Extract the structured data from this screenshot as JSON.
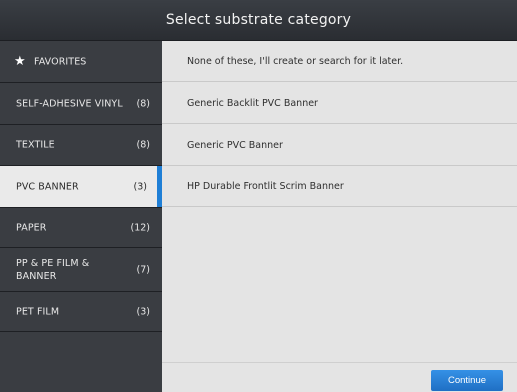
{
  "header": {
    "title": "Select substrate category"
  },
  "sidebar": {
    "items": [
      {
        "label": "FAVORITES",
        "count": "",
        "icon": "star-icon"
      },
      {
        "label": "SELF-ADHESIVE VINYL",
        "count": "(8)"
      },
      {
        "label": "TEXTILE",
        "count": "(8)"
      },
      {
        "label": "PVC BANNER",
        "count": "(3)",
        "selected": true
      },
      {
        "label": "PAPER",
        "count": "(12)"
      },
      {
        "label": "PP & PE FILM &\nBANNER",
        "count": "(7)"
      },
      {
        "label": "PET FILM",
        "count": "(3)"
      }
    ]
  },
  "main": {
    "rows": [
      "None of these, I'll create or search for it later.",
      "Generic Backlit PVC Banner",
      "Generic PVC Banner",
      "HP Durable Frontlit Scrim Banner"
    ]
  },
  "footer": {
    "continue_label": "Continue"
  },
  "colors": {
    "accent": "#1f7fd6",
    "sidebar_bg": "#3a3d42",
    "content_bg": "#e4e4e4"
  }
}
